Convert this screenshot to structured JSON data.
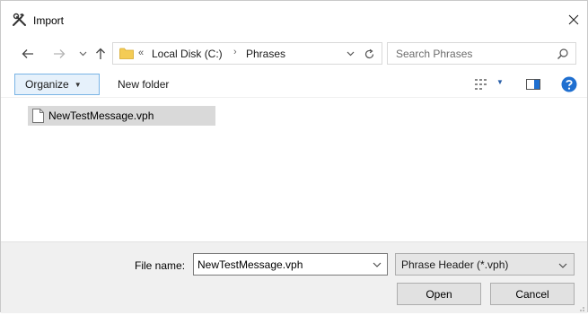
{
  "window": {
    "title": "Import"
  },
  "address": {
    "overflow": "«",
    "crumbs": [
      "Local Disk (C:)",
      "Phrases"
    ]
  },
  "search": {
    "placeholder": "Search Phrases"
  },
  "toolbar": {
    "organize_label": "Organize",
    "new_folder_label": "New folder"
  },
  "files": [
    {
      "name": "NewTestMessage.vph",
      "selected": true
    }
  ],
  "bottom": {
    "file_name_label": "File name:",
    "file_name_value": "NewTestMessage.vph",
    "file_type_value": "Phrase Header (*.vph)",
    "open_label": "Open",
    "cancel_label": "Cancel"
  },
  "icons": {
    "app": "tools-icon",
    "close": "close-icon",
    "back": "back-arrow-icon",
    "forward": "forward-arrow-icon",
    "recent": "chevron-down-icon",
    "up": "up-arrow-icon",
    "folder": "folder-icon",
    "refresh": "refresh-icon",
    "search": "search-icon",
    "view": "view-options-icon",
    "pane": "preview-pane-icon",
    "help": "help-icon",
    "file": "file-icon"
  },
  "colors": {
    "selection": "#d9d9d9",
    "organize_bg": "#e6f1fb",
    "organize_border": "#79b4e5",
    "help_blue": "#1f6fd0",
    "folder_yellow": "#f4cc55",
    "panel_bg": "#f0f0f0"
  }
}
